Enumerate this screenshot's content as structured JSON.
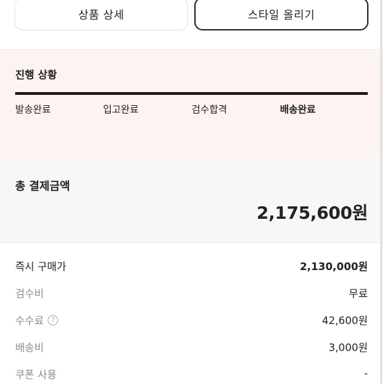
{
  "buttons": {
    "product_detail": "상품 상세",
    "post_style": "스타일 올리기"
  },
  "progress": {
    "title": "진행 상황",
    "steps": [
      {
        "label": "발송완료",
        "current": false
      },
      {
        "label": "입고완료",
        "current": false
      },
      {
        "label": "검수합격",
        "current": false
      },
      {
        "label": "배송완료",
        "current": true
      }
    ],
    "completion": 1.0
  },
  "total": {
    "label": "총 결제금액",
    "amount": "2,175,600원"
  },
  "details": [
    {
      "label": "즉시 구매가",
      "value": "2,130,000원",
      "emphasis": true
    },
    {
      "label": "검수비",
      "value": "무료"
    },
    {
      "label": "수수료",
      "value": "42,600원",
      "icon": "question-circle-icon"
    },
    {
      "label": "배송비",
      "value": "3,000원"
    },
    {
      "label": "쿠폰 사용",
      "value": "-"
    }
  ],
  "colors": {
    "progress_background": "#fdf3f3",
    "total_background": "#f7f7f7",
    "text_primary": "#222222",
    "text_secondary": "#8c8c8c"
  }
}
